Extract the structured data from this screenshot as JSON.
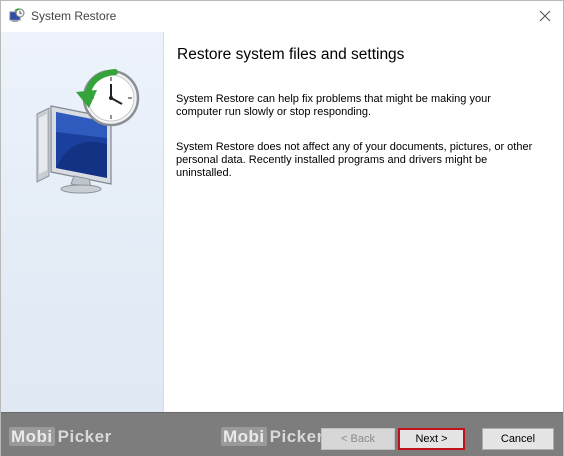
{
  "window": {
    "title": "System Restore"
  },
  "content": {
    "heading": "Restore system files and settings",
    "paragraph_1": "System Restore can help fix problems that might be making your computer run slowly or stop responding.",
    "paragraph_2": "System Restore does not affect any of your documents, pictures, or other personal data. Recently installed programs and drivers might be uninstalled."
  },
  "buttons": {
    "back_label": "< Back",
    "next_label": "Next >",
    "cancel_label": "Cancel"
  },
  "watermark": {
    "part_1": "Mobi",
    "part_2": "Picker"
  },
  "icons": {
    "title_icon": "system-restore-icon",
    "close_icon": "close-icon",
    "hero_icon": "system-restore-hero-icon"
  },
  "colors": {
    "highlight": "#c0121b",
    "left_pane": "#e5edf7",
    "bottom_bar": "#7d7d7d"
  }
}
